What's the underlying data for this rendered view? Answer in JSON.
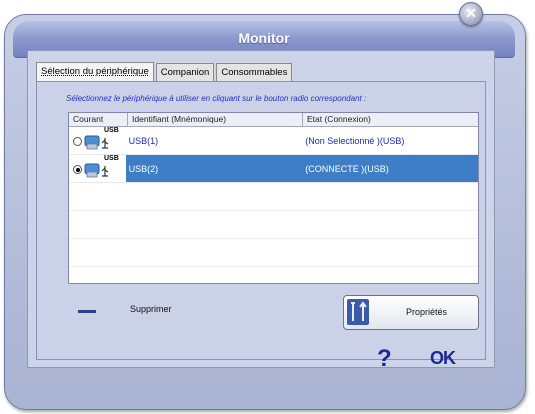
{
  "window": {
    "title": "Monitor"
  },
  "tabs": [
    {
      "label": "Sélection du périphérique",
      "active": true
    },
    {
      "label": "Companion",
      "active": false
    },
    {
      "label": "Consommables",
      "active": false
    }
  ],
  "hint": "Sélectionnez le périphérique à utiliser en cliquant sur le bouton radio correspondant :",
  "list": {
    "headers": [
      "Courant",
      "Identifiant (Mnémonique)",
      "Etat (Connexion)"
    ],
    "rows": [
      {
        "selected": false,
        "icon_label": "USB",
        "id": "USB(1)",
        "state": "(Non Selectionné )(USB)"
      },
      {
        "selected": true,
        "icon_label": "USB",
        "id": "USB(2)",
        "state": "(CONNECTE )(USB)"
      }
    ]
  },
  "actions": {
    "delete_label": "Supprimer",
    "properties_label": "Propriétés",
    "help_label": "?",
    "ok_label": "OK"
  },
  "colors": {
    "selection": "#3e7ec6",
    "title_bar": "#8e9bcf",
    "accent_text": "#1b2a93"
  }
}
